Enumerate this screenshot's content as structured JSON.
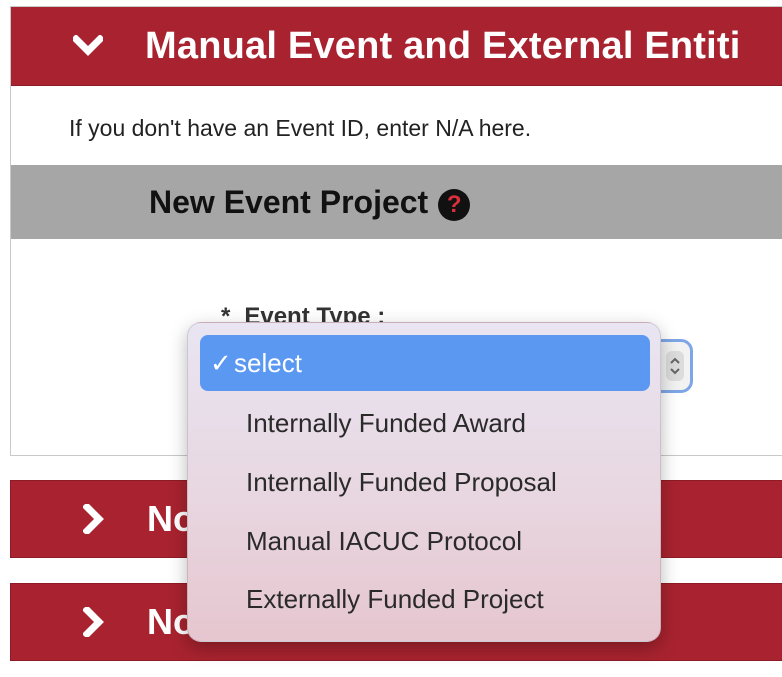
{
  "panels": {
    "main": {
      "title": "Manual Event and External Entiti",
      "info_text": "If you don't have an Event ID, enter N/A here.",
      "subheader_title": "New Event Project",
      "help_icon": "question-circle-icon",
      "field": {
        "required_marker": "*",
        "label": "Event Type :"
      }
    },
    "collapsed": [
      {
        "title": "No"
      },
      {
        "title": "No"
      }
    ]
  },
  "dropdown": {
    "check_glyph": "✓",
    "options": [
      {
        "label": "select",
        "selected": true
      },
      {
        "label": "Internally Funded Award",
        "selected": false
      },
      {
        "label": "Internally Funded Proposal",
        "selected": false
      },
      {
        "label": "Manual IACUC Protocol",
        "selected": false
      },
      {
        "label": "Externally Funded Project",
        "selected": false
      }
    ]
  },
  "colors": {
    "panel_header": "#a8232f",
    "subheader": "#a6a6a6",
    "selected_option": "#5a98f2",
    "help_icon_mark": "#d9303b"
  }
}
